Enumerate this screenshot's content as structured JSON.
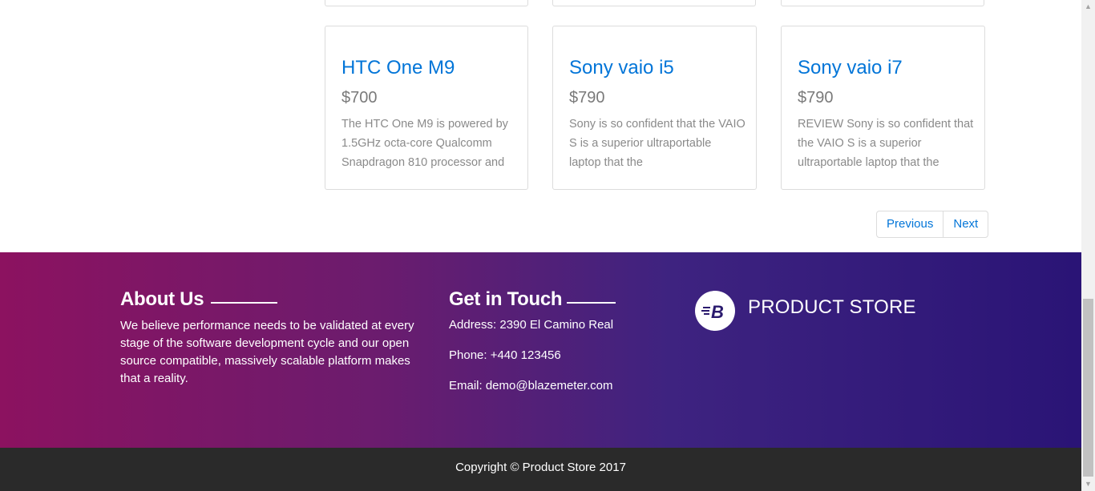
{
  "products": [
    {
      "title": "HTC One M9",
      "price": "$700",
      "description": "The HTC One M9 is powered by 1.5GHz octa-core Qualcomm Snapdragon 810 processor and"
    },
    {
      "title": "Sony vaio i5",
      "price": "$790",
      "description": "Sony is so confident that the VAIO S is a superior ultraportable laptop that the"
    },
    {
      "title": "Sony vaio i7",
      "price": "$790",
      "description": "REVIEW Sony is so confident that the VAIO S is a superior ultraportable laptop that the"
    }
  ],
  "pagination": {
    "previous_label": "Previous",
    "next_label": "Next"
  },
  "footer": {
    "about": {
      "title": "About Us",
      "text": "We believe performance needs to be validated at every stage of the software development cycle and our open source compatible, massively scalable platform makes that a reality."
    },
    "contact": {
      "title": "Get in Touch",
      "address": "Address: 2390 El Camino Real",
      "phone": "Phone: +440 123456",
      "email": "Email: demo@blazemeter.com"
    },
    "brand": {
      "logo_icon": "blazemeter-logo-icon",
      "name": "PRODUCT STORE"
    }
  },
  "copyright": "Copyright © Product Store 2017",
  "colors": {
    "link": "#0275d8",
    "footer_gradient_start": "#8c1260",
    "footer_gradient_end": "#2a1476",
    "copyright_bg": "#2a2a2a"
  }
}
